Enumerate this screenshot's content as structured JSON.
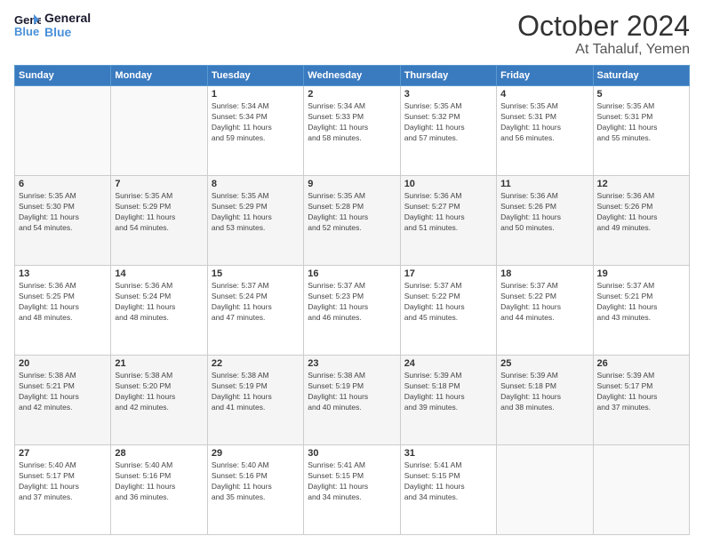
{
  "header": {
    "logo_line1": "General",
    "logo_line2": "Blue",
    "month": "October 2024",
    "location": "At Tahaluf, Yemen"
  },
  "weekdays": [
    "Sunday",
    "Monday",
    "Tuesday",
    "Wednesday",
    "Thursday",
    "Friday",
    "Saturday"
  ],
  "rows": [
    [
      {
        "day": "",
        "info": ""
      },
      {
        "day": "",
        "info": ""
      },
      {
        "day": "1",
        "info": "Sunrise: 5:34 AM\nSunset: 5:34 PM\nDaylight: 11 hours\nand 59 minutes."
      },
      {
        "day": "2",
        "info": "Sunrise: 5:34 AM\nSunset: 5:33 PM\nDaylight: 11 hours\nand 58 minutes."
      },
      {
        "day": "3",
        "info": "Sunrise: 5:35 AM\nSunset: 5:32 PM\nDaylight: 11 hours\nand 57 minutes."
      },
      {
        "day": "4",
        "info": "Sunrise: 5:35 AM\nSunset: 5:31 PM\nDaylight: 11 hours\nand 56 minutes."
      },
      {
        "day": "5",
        "info": "Sunrise: 5:35 AM\nSunset: 5:31 PM\nDaylight: 11 hours\nand 55 minutes."
      }
    ],
    [
      {
        "day": "6",
        "info": "Sunrise: 5:35 AM\nSunset: 5:30 PM\nDaylight: 11 hours\nand 54 minutes."
      },
      {
        "day": "7",
        "info": "Sunrise: 5:35 AM\nSunset: 5:29 PM\nDaylight: 11 hours\nand 54 minutes."
      },
      {
        "day": "8",
        "info": "Sunrise: 5:35 AM\nSunset: 5:29 PM\nDaylight: 11 hours\nand 53 minutes."
      },
      {
        "day": "9",
        "info": "Sunrise: 5:35 AM\nSunset: 5:28 PM\nDaylight: 11 hours\nand 52 minutes."
      },
      {
        "day": "10",
        "info": "Sunrise: 5:36 AM\nSunset: 5:27 PM\nDaylight: 11 hours\nand 51 minutes."
      },
      {
        "day": "11",
        "info": "Sunrise: 5:36 AM\nSunset: 5:26 PM\nDaylight: 11 hours\nand 50 minutes."
      },
      {
        "day": "12",
        "info": "Sunrise: 5:36 AM\nSunset: 5:26 PM\nDaylight: 11 hours\nand 49 minutes."
      }
    ],
    [
      {
        "day": "13",
        "info": "Sunrise: 5:36 AM\nSunset: 5:25 PM\nDaylight: 11 hours\nand 48 minutes."
      },
      {
        "day": "14",
        "info": "Sunrise: 5:36 AM\nSunset: 5:24 PM\nDaylight: 11 hours\nand 48 minutes."
      },
      {
        "day": "15",
        "info": "Sunrise: 5:37 AM\nSunset: 5:24 PM\nDaylight: 11 hours\nand 47 minutes."
      },
      {
        "day": "16",
        "info": "Sunrise: 5:37 AM\nSunset: 5:23 PM\nDaylight: 11 hours\nand 46 minutes."
      },
      {
        "day": "17",
        "info": "Sunrise: 5:37 AM\nSunset: 5:22 PM\nDaylight: 11 hours\nand 45 minutes."
      },
      {
        "day": "18",
        "info": "Sunrise: 5:37 AM\nSunset: 5:22 PM\nDaylight: 11 hours\nand 44 minutes."
      },
      {
        "day": "19",
        "info": "Sunrise: 5:37 AM\nSunset: 5:21 PM\nDaylight: 11 hours\nand 43 minutes."
      }
    ],
    [
      {
        "day": "20",
        "info": "Sunrise: 5:38 AM\nSunset: 5:21 PM\nDaylight: 11 hours\nand 42 minutes."
      },
      {
        "day": "21",
        "info": "Sunrise: 5:38 AM\nSunset: 5:20 PM\nDaylight: 11 hours\nand 42 minutes."
      },
      {
        "day": "22",
        "info": "Sunrise: 5:38 AM\nSunset: 5:19 PM\nDaylight: 11 hours\nand 41 minutes."
      },
      {
        "day": "23",
        "info": "Sunrise: 5:38 AM\nSunset: 5:19 PM\nDaylight: 11 hours\nand 40 minutes."
      },
      {
        "day": "24",
        "info": "Sunrise: 5:39 AM\nSunset: 5:18 PM\nDaylight: 11 hours\nand 39 minutes."
      },
      {
        "day": "25",
        "info": "Sunrise: 5:39 AM\nSunset: 5:18 PM\nDaylight: 11 hours\nand 38 minutes."
      },
      {
        "day": "26",
        "info": "Sunrise: 5:39 AM\nSunset: 5:17 PM\nDaylight: 11 hours\nand 37 minutes."
      }
    ],
    [
      {
        "day": "27",
        "info": "Sunrise: 5:40 AM\nSunset: 5:17 PM\nDaylight: 11 hours\nand 37 minutes."
      },
      {
        "day": "28",
        "info": "Sunrise: 5:40 AM\nSunset: 5:16 PM\nDaylight: 11 hours\nand 36 minutes."
      },
      {
        "day": "29",
        "info": "Sunrise: 5:40 AM\nSunset: 5:16 PM\nDaylight: 11 hours\nand 35 minutes."
      },
      {
        "day": "30",
        "info": "Sunrise: 5:41 AM\nSunset: 5:15 PM\nDaylight: 11 hours\nand 34 minutes."
      },
      {
        "day": "31",
        "info": "Sunrise: 5:41 AM\nSunset: 5:15 PM\nDaylight: 11 hours\nand 34 minutes."
      },
      {
        "day": "",
        "info": ""
      },
      {
        "day": "",
        "info": ""
      }
    ]
  ]
}
